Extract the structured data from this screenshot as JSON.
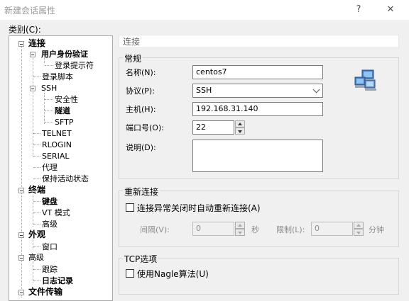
{
  "window": {
    "title": "新建会话属性",
    "help_label": "?",
    "close_label": "✕"
  },
  "category_label": "类别(C):",
  "tree": {
    "connection": "连接",
    "user_auth": "用户身份验证",
    "login_prompt": "登录提示符",
    "login_script": "登录脚本",
    "ssh": "SSH",
    "security": "安全性",
    "tunnel": "隧道",
    "sftp": "SFTP",
    "telnet": "TELNET",
    "rlogin": "RLOGIN",
    "serial": "SERIAL",
    "proxy": "代理",
    "keepalive": "保持活动状态",
    "terminal": "终端",
    "keyboard": "键盘",
    "vt_mode": "VT 模式",
    "advanced": "高级",
    "appearance": "外观",
    "window": "窗口",
    "advanced2": "高级",
    "trace": "跟踪",
    "log": "日志记录",
    "file_transfer": "文件传输"
  },
  "section_header": "连接",
  "general": {
    "title": "常规",
    "name_label": "名称(N):",
    "name_value": "centos7",
    "protocol_label": "协议(P):",
    "protocol_value": "SSH",
    "host_label": "主机(H):",
    "host_value": "192.168.31.140",
    "port_label": "端口号(O):",
    "port_value": "22",
    "desc_label": "说明(D):",
    "desc_value": ""
  },
  "reconnect": {
    "title": "重新连接",
    "auto_reconnect_label": "连接异常关闭时自动重新连接(A)",
    "interval_label": "间隔(V):",
    "interval_value": "0",
    "seconds_label": "秒",
    "limit_label": "限制(L):",
    "limit_value": "0",
    "minutes_label": "分钟"
  },
  "tcp": {
    "title": "TCP选项",
    "nagle_label": "使用Nagle算法(U)"
  },
  "icon": "network-computers-icon"
}
